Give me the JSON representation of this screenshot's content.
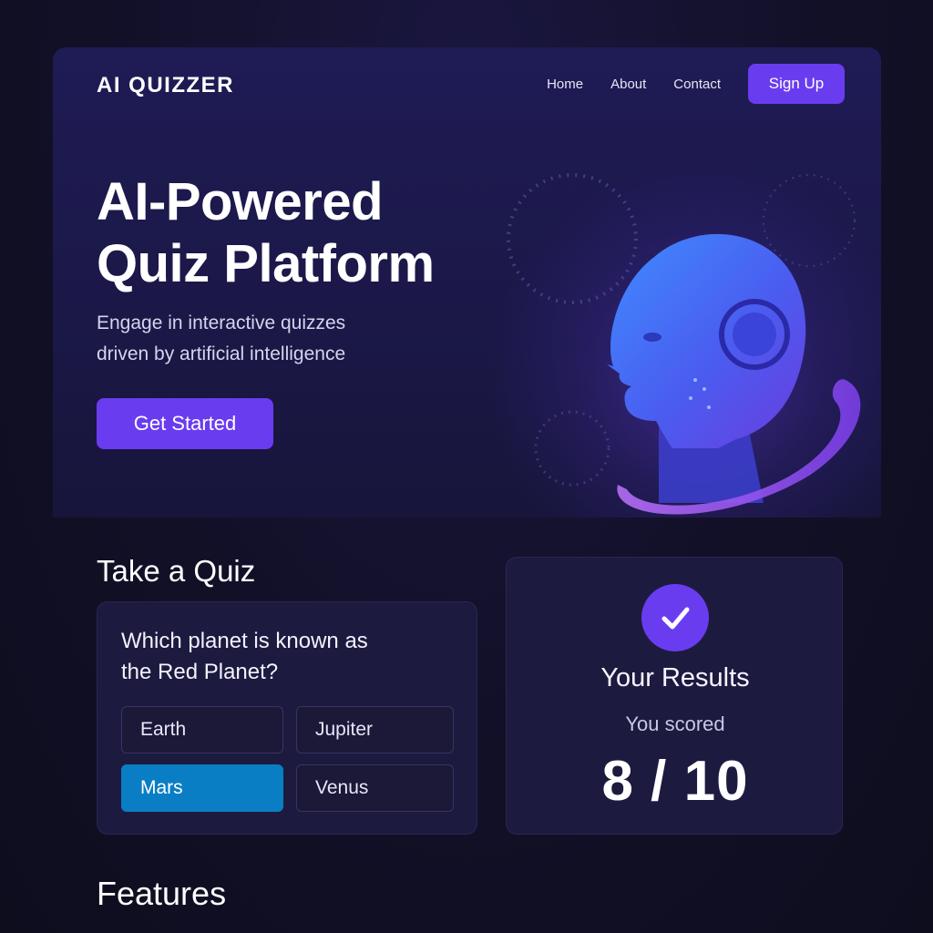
{
  "brand": {
    "logo": "AI QUIZZER"
  },
  "nav": {
    "links": [
      "Home",
      "About",
      "Contact"
    ],
    "signup_label": "Sign Up"
  },
  "hero": {
    "title_line1": "AI-Powered",
    "title_line2": "Quiz Platform",
    "subtitle_line1": "Engage in interactive quizzes",
    "subtitle_line2": "driven by artificial intelligence",
    "cta_label": "Get Started",
    "illustration_icon": "ai-head-illustration"
  },
  "quiz": {
    "section_title": "Take a Quiz",
    "question_line1": "Which planet is known as",
    "question_line2": "the Red Planet?",
    "options": [
      {
        "label": "Earth",
        "selected": false
      },
      {
        "label": "Jupiter",
        "selected": false
      },
      {
        "label": "Mars",
        "selected": true
      },
      {
        "label": "Venus",
        "selected": false
      }
    ]
  },
  "results": {
    "icon": "checkmark-icon",
    "title": "Your Results",
    "scored_label": "You scored",
    "score": "8 / 10"
  },
  "features": {
    "section_title": "Features"
  },
  "colors": {
    "accent": "#6a3cf0",
    "selected_option": "#0a7ec4",
    "background": "#100f22",
    "card": "#1d1a40"
  }
}
